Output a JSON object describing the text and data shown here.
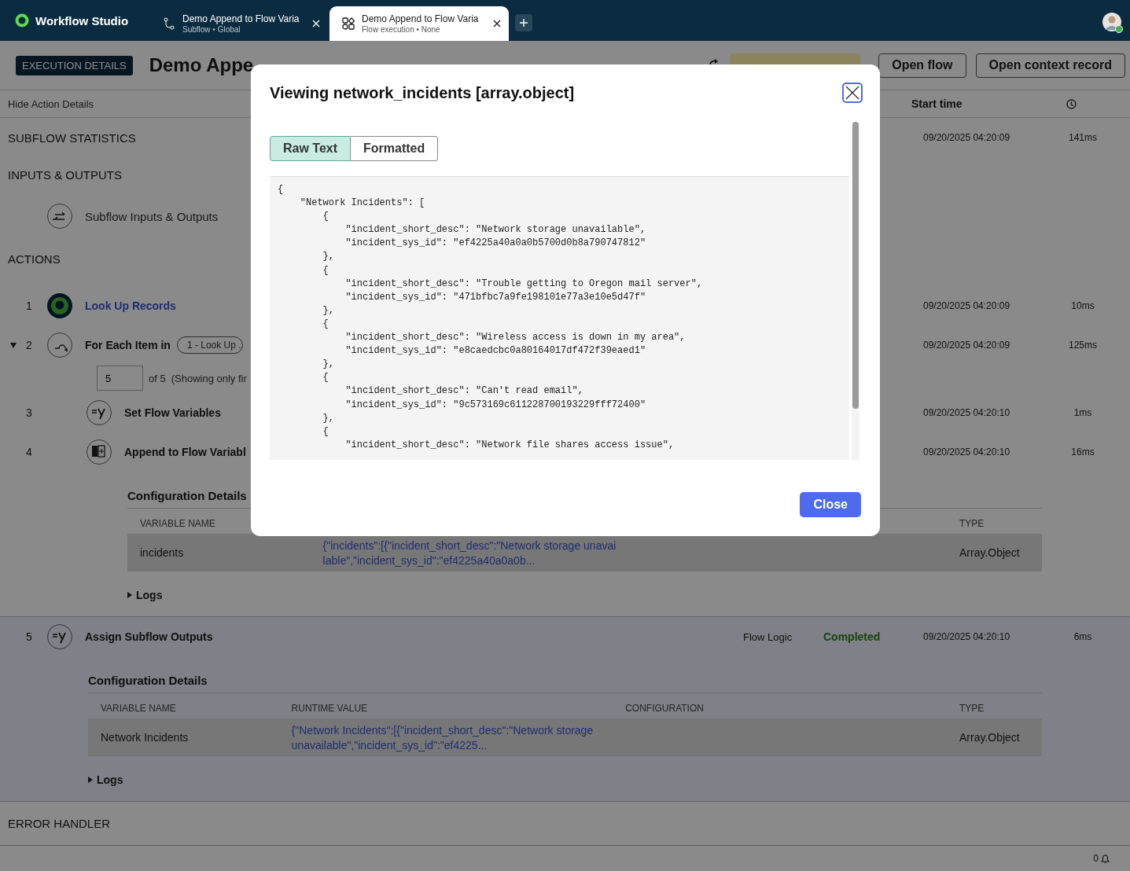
{
  "topbar": {
    "app_name": "Workflow Studio",
    "tabs": [
      {
        "title": "Demo Append to Flow Varia",
        "subtitle": "Subflow • Global",
        "kind": "subflow",
        "selected": false
      },
      {
        "title": "Demo Append to Flow Varia",
        "subtitle": "Flow execution • None",
        "kind": "execution",
        "selected": true
      }
    ]
  },
  "header": {
    "badge": "EXECUTION DETAILS",
    "title": "Demo Appe",
    "buttons": [
      "Open flow",
      "Open context record"
    ]
  },
  "columns_bar": {
    "toggle": "Hide Action Details",
    "start_time": "Start time"
  },
  "subflow_statistics": {
    "label": "SUBFLOW STATISTICS",
    "start_time": "09/20/2025 04:20:09",
    "duration": "141ms"
  },
  "inputs_outputs": {
    "label": "INPUTS & OUTPUTS",
    "item": "Subflow Inputs & Outputs"
  },
  "actions": {
    "label": "ACTIONS",
    "items": [
      {
        "number": "1",
        "kind": "lookup",
        "name": "Look Up Records",
        "link": true,
        "selected": false,
        "start_time": "09/20/2025 04:20:09",
        "duration": "10ms"
      },
      {
        "number": "2",
        "kind": "loop",
        "name": "For Each Item in",
        "source": "1 - Look Up .",
        "expanded": true,
        "iteration": {
          "value": "5",
          "of": "of 5",
          "note": "(Showing only fir"
        },
        "link": false,
        "selected": false,
        "start_time": "09/20/2025 04:20:09",
        "duration": "125ms",
        "children": [
          {
            "number": "3",
            "kind": "set_variables",
            "name": "Set Flow Variables",
            "link": false,
            "selected": false,
            "start_time": "09/20/2025 04:20:10",
            "duration": "1ms"
          },
          {
            "number": "4",
            "kind": "append",
            "name": "Append to Flow Variabl",
            "link": false,
            "selected": false,
            "start_time": "09/20/2025 04:20:10",
            "duration": "16ms",
            "details": {
              "title": "Configuration Details",
              "columns": [
                {
                  "kind": "name",
                  "label": "VARIABLE NAME"
                },
                {
                  "kind": "type",
                  "label": "TYPE"
                }
              ],
              "rows": [
                {
                  "name": "incidents",
                  "value": "{\"incidents\":[{\"incident_short_desc\":\"Network storage unavailable\",\"incident_sys_id\":\"ef4225a40a0a0b...",
                  "type": "Array.Object"
                }
              ],
              "logs": "Logs"
            }
          }
        ]
      },
      {
        "number": "5",
        "kind": "assign",
        "name": "Assign Subflow Outputs",
        "link": false,
        "selected": true,
        "type": "Flow Logic",
        "status": "Completed",
        "start_time": "09/20/2025 04:20:10",
        "duration": "6ms",
        "details": {
          "title": "Configuration Details",
          "columns": [
            {
              "kind": "name",
              "label": "VARIABLE NAME"
            },
            {
              "kind": "value",
              "label": "RUNTIME VALUE"
            },
            {
              "kind": "config",
              "label": "CONFIGURATION"
            },
            {
              "kind": "type",
              "label": "TYPE"
            }
          ],
          "rows": [
            {
              "name": "Network Incidents",
              "value": "{\"Network Incidents\":[{\"incident_short_desc\":\"Network storage unavailable\",\"incident_sys_id\":\"ef4225...",
              "type": "Array.Object"
            }
          ],
          "logs": "Logs"
        }
      }
    ]
  },
  "error_handler": {
    "label": "ERROR HANDLER"
  },
  "footer": {
    "notifications": "0"
  },
  "modal": {
    "title": "Viewing network_incidents [array.object]",
    "views": [
      {
        "label": "Raw Text",
        "selected": true
      },
      {
        "label": "Formatted",
        "selected": false
      }
    ],
    "raw_text": [
      "{",
      "    \"Network Incidents\": [",
      "        {",
      "            \"incident_short_desc\": \"Network storage unavailable\",",
      "            \"incident_sys_id\": \"ef4225a40a0a0b5700d0b8a790747812\"",
      "        },",
      "        {",
      "            \"incident_short_desc\": \"Trouble getting to Oregon mail server\",",
      "            \"incident_sys_id\": \"471bfbc7a9fe198101e77a3e10e5d47f\"",
      "        },",
      "        {",
      "            \"incident_short_desc\": \"Wireless access is down in my area\",",
      "            \"incident_sys_id\": \"e8caedcbc0a80164017df472f39eaed1\"",
      "        },",
      "        {",
      "            \"incident_short_desc\": \"Can't read email\",",
      "            \"incident_sys_id\": \"9c573169c611228700193229fff72400\"",
      "        },",
      "        {",
      "            \"incident_short_desc\": \"Network file shares access issue\","
    ],
    "button": "Close"
  }
}
